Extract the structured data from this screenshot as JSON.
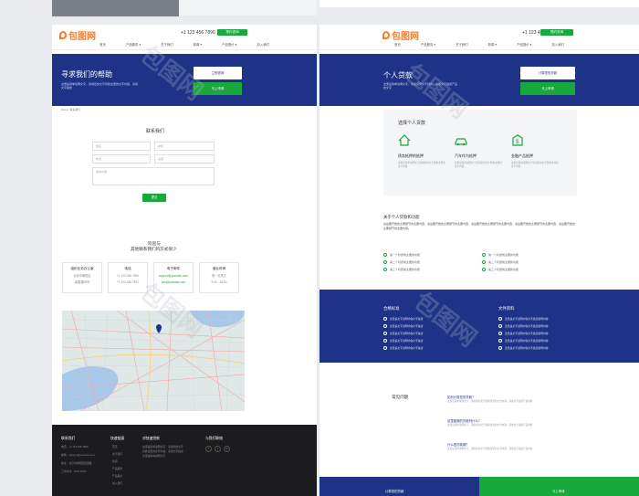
{
  "brand": {
    "logo_text": "包图网",
    "accent": "#ff7a1a",
    "primary": "#1e3388",
    "green": "#18a83b"
  },
  "left": {
    "phone": "+1 123 456 7890",
    "header_button": "预约咨询",
    "nav": [
      "首页",
      "产品服务 ▾",
      "关于我们",
      "新闻 ▾",
      "产品报价 ▾",
      "加入我们"
    ],
    "hero": {
      "title": "寻求我们的帮助",
      "desc": "这里是简单说明文字，请用您的文字替换这里的文字内容，请用文字描述",
      "btn_white": "立即咨询",
      "btn_green": "马上申请"
    },
    "breadcrumb": "Home / 联系我们",
    "form": {
      "title": "联系我们",
      "name_placeholder": "姓名",
      "email_placeholder": "邮箱",
      "phone_placeholder": "电话",
      "subject_placeholder": "主题",
      "message_placeholder": "留言内容",
      "submit": "提交"
    },
    "contact_title_1": "欢迎与",
    "contact_title_2": "其他联系我们的方式很少",
    "cards": [
      {
        "title": "组织业务办公室",
        "lines": [
          "北京市朝阳区",
          "建国路88号"
        ]
      },
      {
        "title": "电话",
        "lines": [
          "+1 123 456 7890",
          "+1 123 456 7891"
        ]
      },
      {
        "title": "电子邮件",
        "lines": [
          "support@yoursite.com",
          "info@yoursite.com"
        ]
      },
      {
        "title": "营业时间",
        "lines": [
          "周一至周五",
          "9:00 - 18:00"
        ]
      }
    ],
    "footer": {
      "col1_title": "联系我们",
      "col1_lines": [
        "电话：+1 123 456 7890",
        "邮箱：support@yoursite.com",
        "地址：北京市朝阳区建国路",
        "工作时间：9:00-18:00"
      ],
      "col2_title": "快速链接",
      "col2_links": [
        "首页",
        "关于我们",
        "新闻",
        "产品服务",
        "产品报价",
        "加入我们"
      ],
      "col3_title": "对快速贷款",
      "col3_lines": [
        "这里是简单说明文字，请用您的文字",
        "替换这里的文字内容，请用文字描述",
        "这里是简单说明文字"
      ],
      "col4_title": "与我们联络",
      "social": [
        "f",
        "t",
        "in"
      ]
    }
  },
  "right": {
    "phone": "+1 123 456 7890",
    "header_button": "预约咨询",
    "nav": [
      "首页",
      "产品服务 ▾",
      "关于我们",
      "新闻 ▾",
      "产品报价 ▾",
      "加入我们"
    ],
    "hero": {
      "title": "个人贷款",
      "desc": "这里是简单说明文字，请用您的文字替换，请用文字描述产品的文字",
      "btn_white": "计算您的贷款",
      "btn_green": "马上申请"
    },
    "choose_title": "选择个人贷款",
    "choose_cols": [
      {
        "icon": "house-icon",
        "title": "债务抵押的抵押",
        "desc": "这里是简单说明文字请用您的文字替换这里的文字内容"
      },
      {
        "icon": "car-icon",
        "title": "汽车作为抵押",
        "desc": "这里是简单说明文字请用您的文字替换这里的文字内容"
      },
      {
        "icon": "money-icon",
        "title": "金融产品抵押",
        "desc": "这里是简单说明文字请用您的文字替换这里的文字内容"
      }
    ],
    "about_title": "关于个人贷款和功能",
    "about_desc": "这是要开始的主要细节的主要内容，这是要开始的主要细节的主要内容，这是要开始的主要细节的主要内容，这是要开始的主要细节的主要内容，这是要开始的主要细节的主要内容。",
    "features_left": [
      "第一个标题或主要的功能",
      "第二个标题或主要的功能",
      "第三个标题或主要的功能"
    ],
    "features_right": [
      "第一个标题或主要的功能",
      "第二个标题或主要的功能",
      "第三个标题或主要的功能"
    ],
    "blue_left_title": "合格标准",
    "blue_left_items": [
      "这里是文字说明内容文字描述",
      "这里是文字说明内容文字描述",
      "这里是文字说明内容文字描述",
      "这里是文字说明内容文字描述",
      "这里是文字说明内容文字描述"
    ],
    "blue_right_title": "文件资料",
    "blue_right_items": [
      "这里是文字说明内容文字描述说明内容",
      "这里是文字说明内容文字描述说明内容",
      "这里是文字说明内容文字描述说明内容",
      "这里是文字说明内容文字描述说明内容",
      "这里是文字说明内容文字描述说明内容"
    ],
    "faq_title": "常见问题",
    "faq": [
      {
        "q": "如何计算您的贷款？",
        "a": "这里是简单说明文字，请用您的文字替换这里的文字内容，请用文字描述产品内容"
      },
      {
        "q": "这里能借的贷款吗什么？",
        "a": "这里是简单说明文字，请用您的文字替换这里的文字内容，请用文字描述产品内容"
      },
      {
        "q": "什么是贷款期？",
        "a": "这里是简单说明文字，请用您的文字替换这里的文字内容，请用文字描述产品内容"
      }
    ],
    "bottom_left": "计算您的贷款",
    "bottom_right": "马上申请"
  }
}
